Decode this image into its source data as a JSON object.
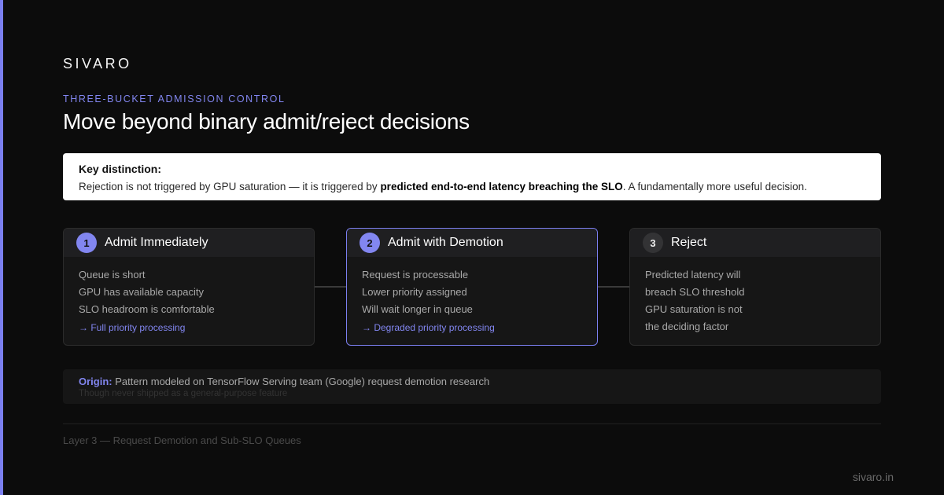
{
  "brand": "SIVARO",
  "eyebrow": "THREE-BUCKET ADMISSION CONTROL",
  "title": "Move beyond binary admit/reject decisions",
  "key_box": {
    "title": "Key distinction:",
    "text_before": "Rejection is not triggered by GPU saturation — it is triggered by ",
    "text_bold": "predicted end-to-end latency breaching the SLO",
    "text_after": ". A fundamentally more useful decision."
  },
  "cards": [
    {
      "number": "1",
      "title": "Admit Immediately",
      "lines": [
        "Queue is short",
        "GPU has available capacity",
        "SLO headroom is comfortable"
      ],
      "outcome": "→ Full priority processing"
    },
    {
      "number": "2",
      "title": "Admit with Demotion",
      "lines": [
        "Request is processable",
        "Lower priority assigned",
        "Will wait longer in queue"
      ],
      "outcome": "→ Degraded priority processing"
    },
    {
      "number": "3",
      "title": "Reject",
      "lines": [
        "Predicted latency will",
        "breach SLO threshold",
        "GPU saturation is not",
        "the deciding factor"
      ]
    }
  ],
  "origin": {
    "label": "Origin:",
    "text": " Pattern modeled on TensorFlow Serving team (Google) request demotion research",
    "subtext": "Though never shipped as a general-purpose feature"
  },
  "footer": {
    "left": "Layer 3 — Request Demotion and Sub-SLO Queues",
    "right": "sivaro.in"
  },
  "colors": {
    "accent": "#7b7ff0",
    "background": "#0c0c0c",
    "card": "#161616"
  }
}
